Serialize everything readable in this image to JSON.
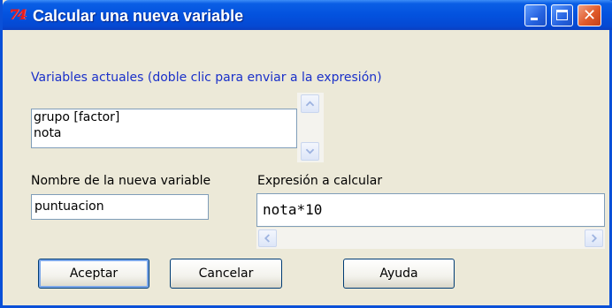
{
  "window": {
    "title": "Calcular una nueva variable",
    "app_icon_text": "74",
    "close_symbol": "✕"
  },
  "current_vars": {
    "label": "Variables actuales (doble clic para enviar a la expresión)",
    "items": [
      "grupo [factor]",
      "nota"
    ]
  },
  "new_var": {
    "label": "Nombre de la nueva variable",
    "value": "puntuacion"
  },
  "expression": {
    "label": "Expresión a calcular",
    "value": "nota*10"
  },
  "buttons": {
    "accept": "Aceptar",
    "cancel": "Cancelar",
    "help": "Ayuda"
  },
  "colors": {
    "titlebar": "#0352de",
    "label_accent": "#1a30c9",
    "close_button": "#e05a2b"
  },
  "icons": {
    "minimize": "minimize-icon",
    "maximize": "maximize-icon",
    "close": "close-icon",
    "scroll_up": "chevron-up-icon",
    "scroll_down": "chevron-down-icon",
    "scroll_left": "chevron-left-icon",
    "scroll_right": "chevron-right-icon"
  }
}
